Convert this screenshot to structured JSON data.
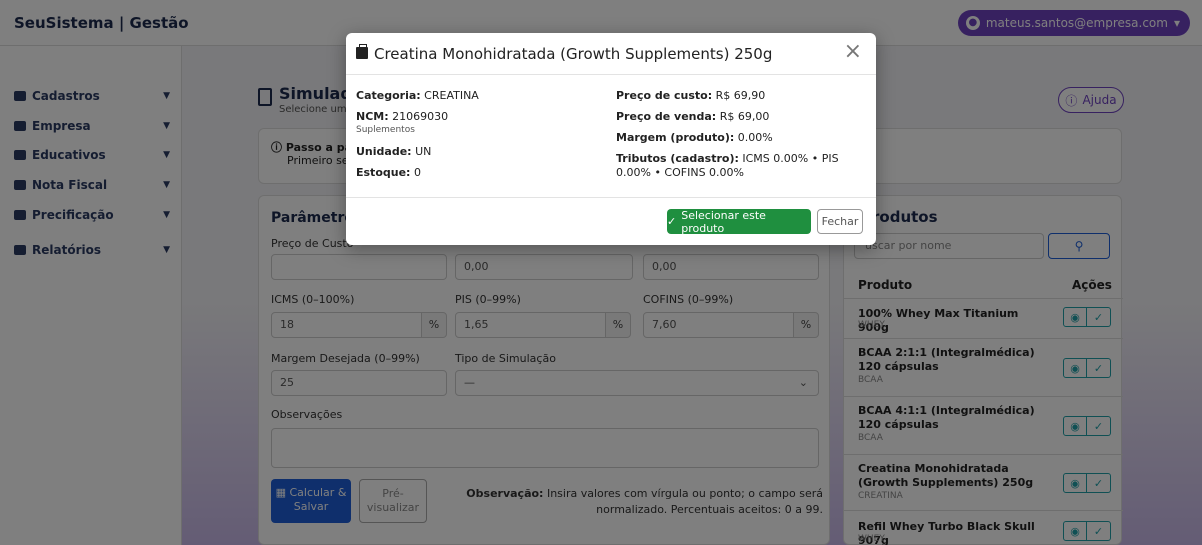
{
  "header": {
    "brand": "SeuSistema | Gestão",
    "user": "mateus.santos@empresa.com"
  },
  "sidebar": {
    "items": [
      {
        "label": "Cadastros"
      },
      {
        "label": "Empresa"
      },
      {
        "label": "Educativos"
      },
      {
        "label": "Nota Fiscal"
      },
      {
        "label": "Precificação"
      },
      {
        "label": "Relatórios"
      }
    ]
  },
  "main": {
    "title": "Simulado",
    "subtitle": "Selecione um p",
    "help_label": "Ajuda",
    "tip_title": "Passo a pass",
    "tip_text": "Primeiro sele",
    "tip_tail": "."
  },
  "form": {
    "section_title": "Parâmetros c",
    "cost_label": "Preço de Custo",
    "cost_value": "",
    "field2_value": "0,00",
    "field3_value": "0,00",
    "icms_label": "ICMS (0–100%)",
    "icms_value": "18",
    "pis_label": "PIS (0–99%)",
    "pis_value": "1,65",
    "cofins_label": "COFINS (0–99%)",
    "cofins_value": "7,60",
    "pct": "%",
    "margin_label": "Margem Desejada (0–99%)",
    "margin_value": "25",
    "sim_type_label": "Tipo de Simulação",
    "sim_type_value": "—",
    "obs_label": "Observações",
    "calc_label": "Calcular & Salvar",
    "preview_label": "Pré-visualizar",
    "note_bold": "Observação:",
    "note_text": "Insira valores com vírgula ou ponto; o campo será normalizado. Percentuais aceitos: 0 a 99."
  },
  "products": {
    "title": "rodutos",
    "search_placeholder": "uscar por nome",
    "col_product": "Produto",
    "col_actions": "Ações",
    "rows": [
      {
        "name": "100% Whey Max Titanium 900g",
        "category": "WHEY"
      },
      {
        "name": "BCAA 2:1:1 (Integralmédica) 120 cápsulas",
        "category": "BCAA"
      },
      {
        "name": "BCAA 4:1:1 (Integralmédica) 120 cápsulas",
        "category": "BCAA"
      },
      {
        "name": "Creatina Monohidratada (Growth Supplements) 250g",
        "category": "CREATINA"
      },
      {
        "name": "Refil Whey Turbo Black Skull 907g",
        "category": "WHEY"
      }
    ]
  },
  "modal": {
    "title": "Creatina Monohidratada (Growth Supplements) 250g",
    "category_label": "Categoria:",
    "category_value": "CREATINA",
    "ncm_label": "NCM:",
    "ncm_value": "21069030",
    "ncm_sub": "Suplementos",
    "unit_label": "Unidade:",
    "unit_value": "UN",
    "stock_label": "Estoque:",
    "stock_value": "0",
    "cost_label": "Preço de custo:",
    "cost_value": "R$ 69,90",
    "sale_label": "Preço de venda:",
    "sale_value": "R$ 69,00",
    "margin_label": "Margem (produto):",
    "margin_value": "0.00%",
    "taxes_label": "Tributos (cadastro):",
    "taxes_value": "ICMS 0.00% • PIS 0.00% • COFINS 0.00%",
    "select_label": "Selecionar este produto",
    "close_label": "Fechar"
  }
}
